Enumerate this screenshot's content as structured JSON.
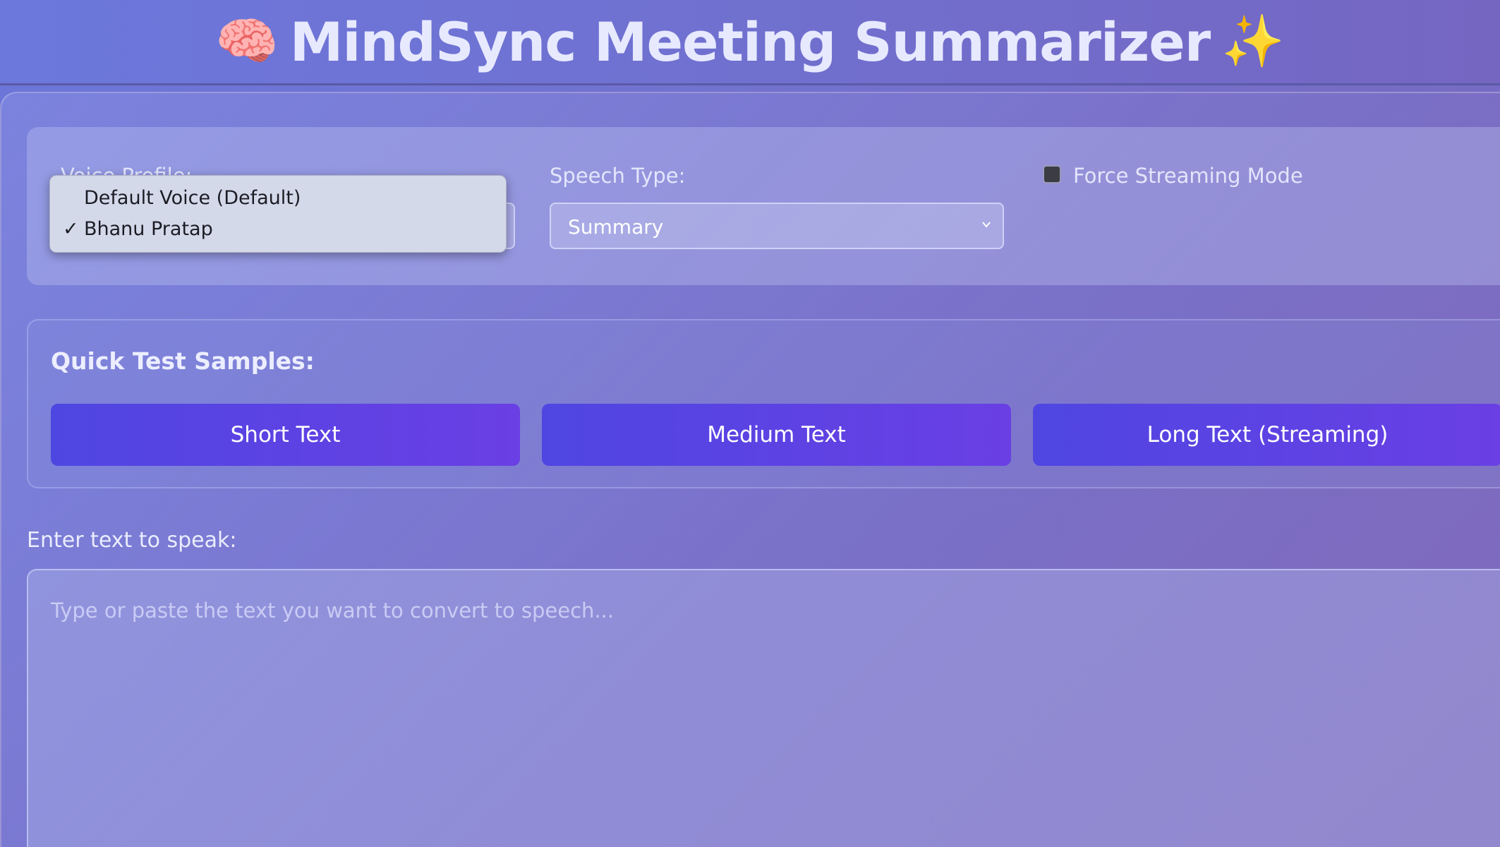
{
  "header": {
    "title": "MindSync Meeting Summarizer",
    "brain_emoji": "🧠",
    "sparkles_emoji": "✨"
  },
  "settings": {
    "voice_profile": {
      "label": "Voice Profile:",
      "options": [
        "Default Voice (Default)",
        "Bhanu Pratap"
      ],
      "selected": "Bhanu Pratap",
      "dropdown_open": true
    },
    "speech_type": {
      "label": "Speech Type:",
      "value": "Summary"
    },
    "force_streaming": {
      "label": "Force Streaming Mode",
      "checked": false
    }
  },
  "samples": {
    "title": "Quick Test Samples:",
    "buttons": [
      "Short Text",
      "Medium Text",
      "Long Text (Streaming)"
    ]
  },
  "input": {
    "label": "Enter text to speak:",
    "placeholder": "Type or paste the text you want to convert to speech..."
  },
  "colors": {
    "button_gradient_start": "#4f46e2",
    "button_gradient_end": "#6a3fe4",
    "title_text": "#e7e9ff"
  }
}
